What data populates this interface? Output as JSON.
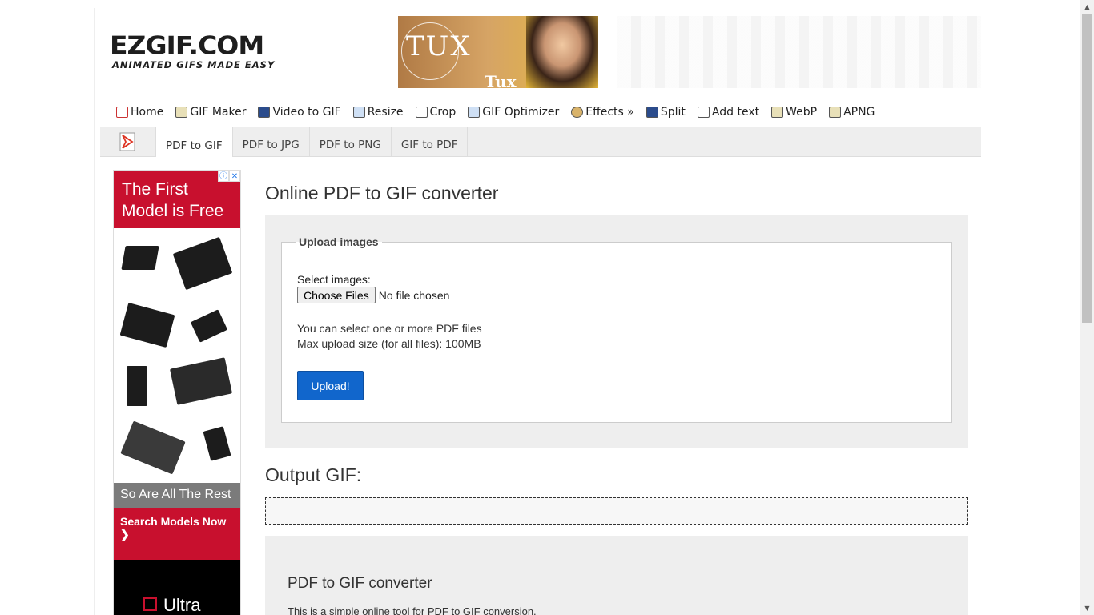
{
  "logo": {
    "main": "EZGIF.COM",
    "tagline": "ANIMATED GIFS MADE EASY"
  },
  "top_ad": {
    "brand": "TUX",
    "brand_small": "Tux"
  },
  "nav": {
    "items": [
      {
        "label": "Home",
        "icon": "home-icon"
      },
      {
        "label": "GIF Maker",
        "icon": "gif-maker-icon"
      },
      {
        "label": "Video to GIF",
        "icon": "video-icon"
      },
      {
        "label": "Resize",
        "icon": "resize-icon"
      },
      {
        "label": "Crop",
        "icon": "crop-icon"
      },
      {
        "label": "GIF Optimizer",
        "icon": "optimizer-icon"
      },
      {
        "label": "Effects »",
        "icon": "effects-icon"
      },
      {
        "label": "Split",
        "icon": "split-icon"
      },
      {
        "label": "Add text",
        "icon": "add-text-icon"
      },
      {
        "label": "WebP",
        "icon": "webp-icon"
      },
      {
        "label": "APNG",
        "icon": "apng-icon"
      }
    ]
  },
  "subnav": {
    "tabs": [
      {
        "label": "PDF to GIF",
        "active": true
      },
      {
        "label": "PDF to JPG",
        "active": false
      },
      {
        "label": "PDF to PNG",
        "active": false
      },
      {
        "label": "GIF to PDF",
        "active": false
      }
    ]
  },
  "side_ad": {
    "headline": "The First Model is Free",
    "mid": "So Are All The Rest",
    "cta": "Search Models Now ❯",
    "footer": "Ultra"
  },
  "main": {
    "title": "Online PDF to GIF converter",
    "upload": {
      "legend": "Upload images",
      "select_label": "Select images:",
      "choose_button": "Choose Files",
      "no_file": "No file chosen",
      "help_line1": "You can select one or more PDF files",
      "help_line2": "Max upload size (for all files): 100MB",
      "upload_button": "Upload!"
    },
    "output_title": "Output GIF:",
    "desc_title": "PDF to GIF converter",
    "desc_text": "This is a simple online tool for PDF to GIF conversion."
  },
  "colors": {
    "accent": "#1166cc",
    "ad_red": "#c8102e",
    "panel_bg": "#eeeeee"
  }
}
